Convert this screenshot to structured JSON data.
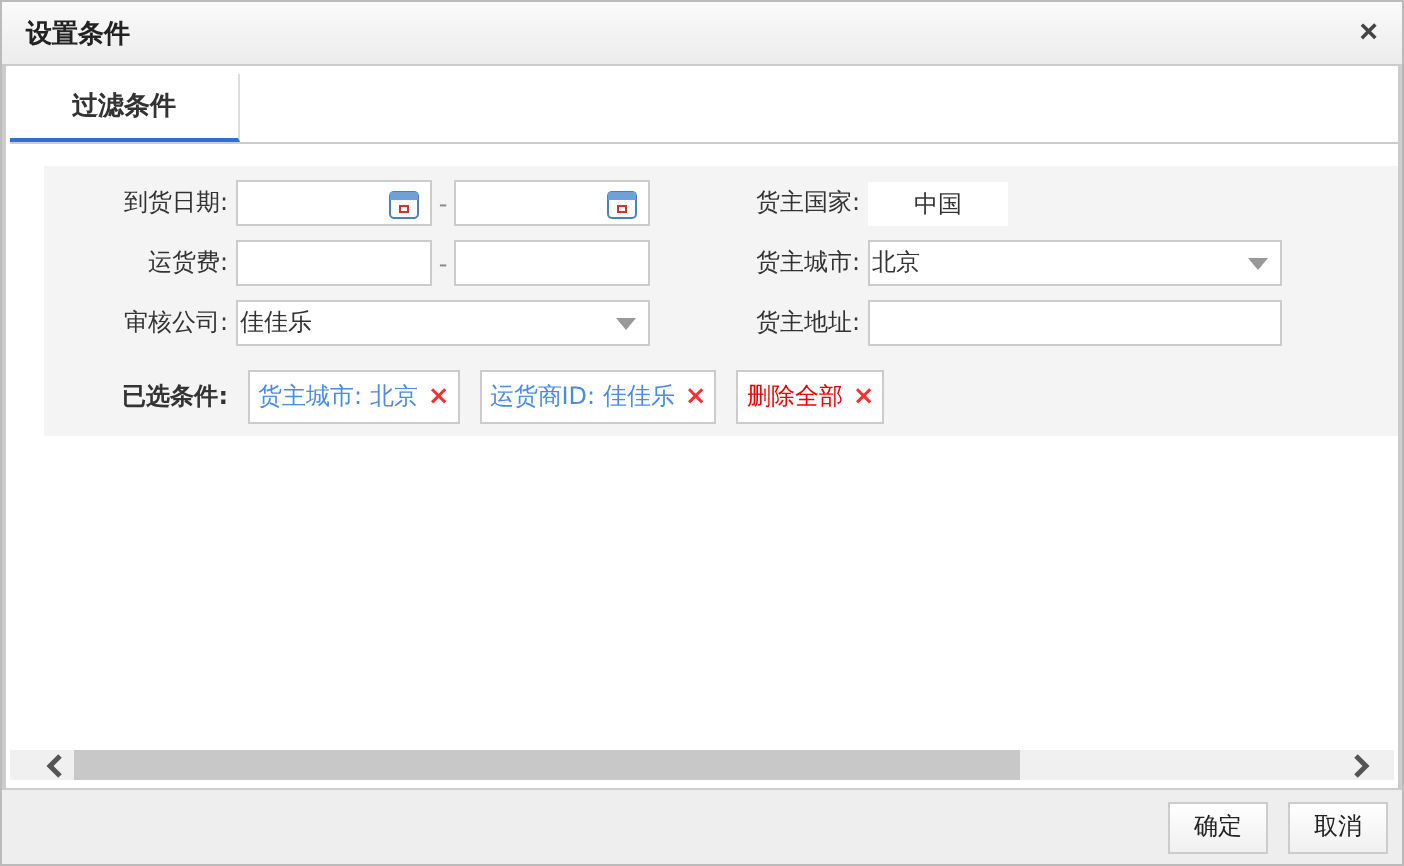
{
  "window": {
    "title": "设置条件",
    "close": "×"
  },
  "tabs": [
    {
      "label": "过滤条件",
      "selected": true
    }
  ],
  "form": {
    "rows": [
      {
        "left": {
          "label": "到货日期:",
          "kind": "date_range",
          "separator": "-"
        },
        "right": {
          "label": "货主国家:",
          "kind": "static",
          "value": "中国"
        }
      },
      {
        "left": {
          "label": "运货费:",
          "kind": "range",
          "separator": "-"
        },
        "right": {
          "label": "货主城市:",
          "kind": "select",
          "value": "北京"
        }
      },
      {
        "left": {
          "label": "审核公司:",
          "kind": "select",
          "value": "佳佳乐"
        },
        "right": {
          "label": "货主地址:",
          "kind": "text"
        }
      }
    ],
    "selected_label": "已选条件:",
    "chips": [
      {
        "kind": "filter",
        "text": "货主城市: 北京",
        "remove": "×"
      },
      {
        "kind": "filter",
        "text": "运货商ID: 佳佳乐",
        "remove": "×"
      },
      {
        "kind": "clear",
        "text": "删除全部",
        "remove": "×"
      }
    ]
  },
  "buttons": [
    {
      "label": "确定"
    },
    {
      "label": "取消"
    }
  ]
}
